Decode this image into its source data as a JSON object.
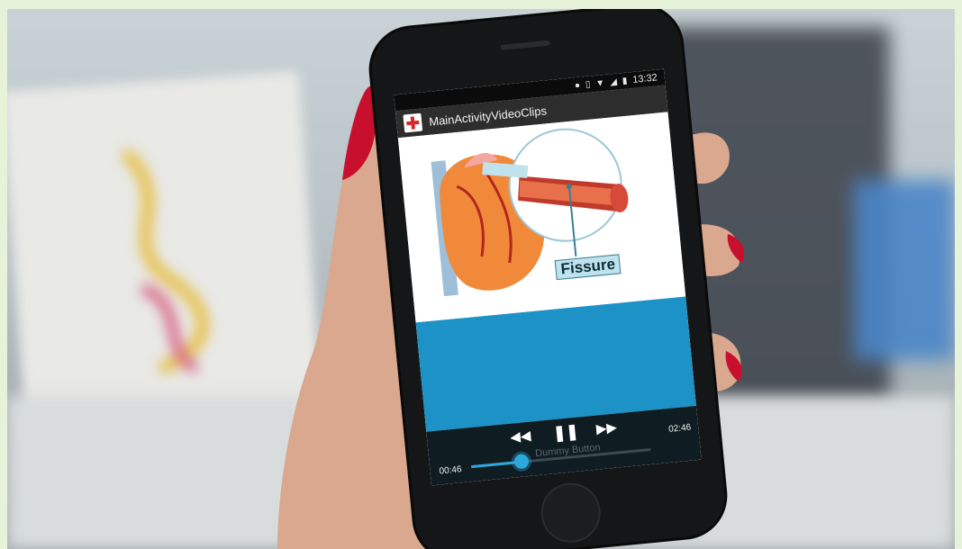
{
  "status_bar": {
    "time": "13:32",
    "icons": [
      "location-icon",
      "vibrate-icon",
      "wifi-icon",
      "signal-icon",
      "battery-icon"
    ]
  },
  "app": {
    "title": "MainActivityVideoClips",
    "icon": "red-cross-icon"
  },
  "video": {
    "annotation": "Fissure"
  },
  "player": {
    "current_time": "00:46",
    "duration": "02:46",
    "progress_fraction": 0.28,
    "dummy_label": "Dummy Button",
    "controls": [
      "rewind-icon",
      "pause-icon",
      "fast-forward-icon"
    ]
  },
  "colors": {
    "accent": "#2ea8dc",
    "video_background": "#1c92c7",
    "action_bar": "#2d2d2d",
    "nail_polish": "#c8102e"
  }
}
